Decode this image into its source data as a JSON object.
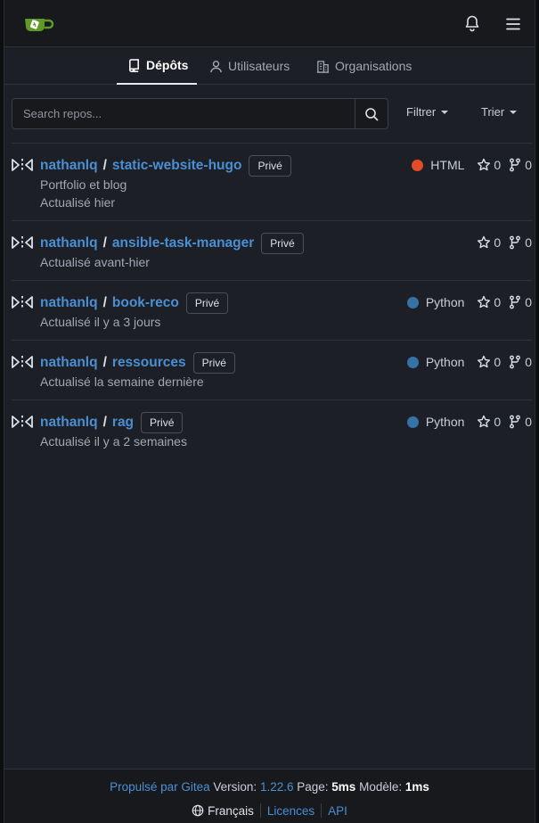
{
  "tabs": [
    {
      "label": "Dépôts",
      "icon": "repo-icon",
      "active": true
    },
    {
      "label": "Utilisateurs",
      "icon": "person-icon",
      "active": false
    },
    {
      "label": "Organisations",
      "icon": "organization-icon",
      "active": false
    }
  ],
  "search": {
    "placeholder": "Search repos..."
  },
  "filters": {
    "filter_label": "Filtrer",
    "sort_label": "Trier"
  },
  "repos": [
    {
      "owner": "nathanlq",
      "name": "static-website-hugo",
      "visibility": "Privé",
      "description": "Portfolio et blog",
      "updated": "Actualisé hier",
      "language": "HTML",
      "language_color": "#e34c26",
      "stars": "0",
      "forks": "0"
    },
    {
      "owner": "nathanlq",
      "name": "ansible-task-manager",
      "visibility": "Privé",
      "description": "",
      "updated": "Actualisé avant-hier",
      "language": "",
      "language_color": "",
      "stars": "0",
      "forks": "0"
    },
    {
      "owner": "nathanlq",
      "name": "book-reco",
      "visibility": "Privé",
      "description": "",
      "updated": "Actualisé il y a 3 jours",
      "language": "Python",
      "language_color": "#3572a5",
      "stars": "0",
      "forks": "0"
    },
    {
      "owner": "nathanlq",
      "name": "ressources",
      "visibility": "Privé",
      "description": "",
      "updated": "Actualisé la semaine dernière",
      "language": "Python",
      "language_color": "#3572a5",
      "stars": "0",
      "forks": "0"
    },
    {
      "owner": "nathanlq",
      "name": "rag",
      "visibility": "Privé",
      "description": "",
      "updated": "Actualisé il y a 2 semaines",
      "language": "Python",
      "language_color": "#3572a5",
      "stars": "0",
      "forks": "0"
    }
  ],
  "footer": {
    "powered_by": "Propulsé par Gitea",
    "version_label": "Version:",
    "version": "1.22.6",
    "page_label": "Page:",
    "page_time": "5ms",
    "template_label": "Modèle:",
    "template_time": "1ms",
    "language": "Français",
    "licenses": "Licences",
    "api": "API"
  }
}
